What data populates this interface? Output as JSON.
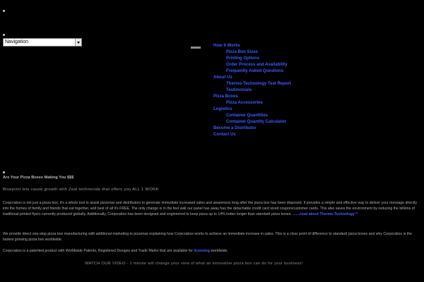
{
  "nav": {
    "select_value": "Navigation"
  },
  "menu": [
    {
      "label": "How It Works",
      "level": 1
    },
    {
      "label": "Pizza Box Sizes",
      "level": 2
    },
    {
      "label": "Printing Options",
      "level": 2
    },
    {
      "label": "Order Process and Availability",
      "level": 2
    },
    {
      "label": "Frequently Asked Questions",
      "level": 2
    },
    {
      "label": "About Us",
      "level": 1
    },
    {
      "label": "Thermo-Technology Test Report",
      "level": 2
    },
    {
      "label": "Testimonials",
      "level": 2
    },
    {
      "label": "Pizza Boxes",
      "level": 1
    },
    {
      "label": "Pizza Accessories",
      "level": 2
    },
    {
      "label": "Logistics",
      "level": 1
    },
    {
      "label": "Container Quantities",
      "level": 2
    },
    {
      "label": "Container Quantity Calculator",
      "level": 2
    },
    {
      "label": "Become a Distributor",
      "level": 1
    },
    {
      "label": "Contact Us",
      "level": 1
    }
  ],
  "content": {
    "heading": "Are Your Pizza Boxes Making You $$$",
    "subhead": "Blueprint lets cause growth with Zeal technocide that offers you ALL 1 WORK",
    "para1": "Corpcrabox is not just a pizza box, it's a whole tool to assist pizzerias and distributors to generate immediate increased sales and awareness long after the pizza box has been disposed. It provides a simple and effective way to deliver your message directly into the homes of family and friends that eat together, and best of all it's FREE. The only change is in the feel wall our panel has away has the detachable credit card sized coupon/customer cards. This also saves the environment by reducing the billions of traditional printed flyers currently produced globally. Additionally, Corpcrabox has been designed and engineered to keep pizza up to 14% hotter longer than standard pizza boxes.",
    "para1_link": ".......read about Thermo-Technology™",
    "para2": "We provide direct one-stop pizza box manufacturing with additional marketing to pizzerias explaining how Corpcrabox works to achieve an immediate increase in sales. This is a clear point of difference to standard pizza boxes and why Corpcrabox is the fastest growing pizza box worldwide.",
    "para3_prefix": "Corpcrabox is a patented product with Worldwide Patents, Registered Designs and Trade Marks that are available for",
    "para3_link": "licensing",
    "para3_suffix": "worldwide.",
    "footer": "WATCH OUR VIDEO - 1 minute will change your view of what an innovative pizza box can do for your business!"
  }
}
